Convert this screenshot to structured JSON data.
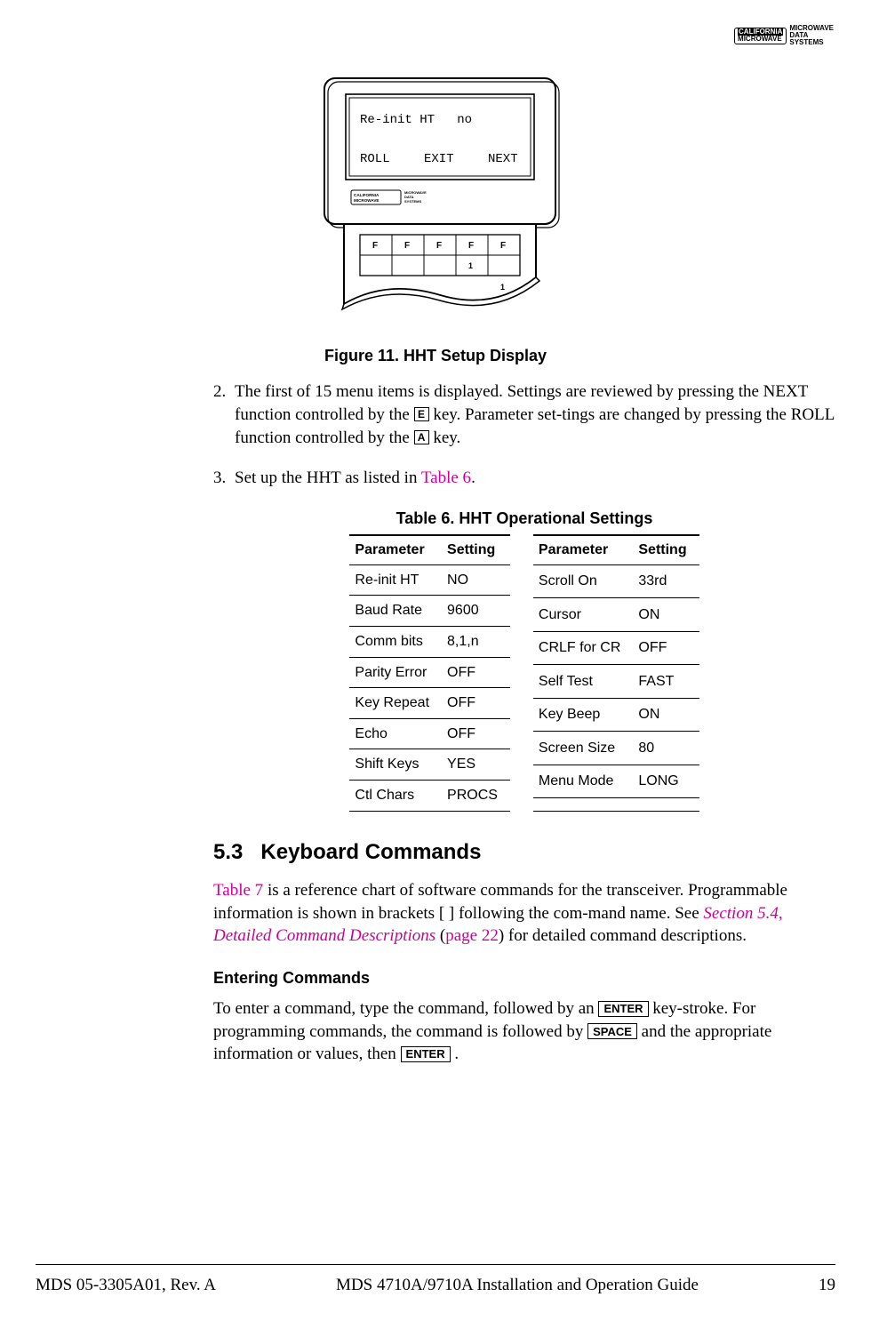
{
  "header": {
    "logo_left_top": "CALIFORNIA",
    "logo_left_bottom": "MICROWAVE",
    "logo_right_l1": "MICROWAVE",
    "logo_right_l2": "DATA",
    "logo_right_l3": "SYSTEMS"
  },
  "figure": {
    "screen_line1": "Re-init HT   no",
    "screen_fn_left": "ROLL",
    "screen_fn_mid": "EXIT",
    "screen_fn_right": "NEXT",
    "caption": "Figure 11. HHT Setup Display",
    "key_F": "F",
    "key_1": "1"
  },
  "steps": {
    "s2_num": "2.",
    "s2_a": "The first of 15 menu items is displayed. Settings are reviewed by pressing the NEXT function controlled by the ",
    "s2_key1": "E",
    "s2_b": " key. Parameter set-tings are changed by pressing the ROLL function controlled by the ",
    "s2_key2": "A",
    "s2_c": " key.",
    "s3_num": "3.",
    "s3_a": "Set up the HHT as listed in ",
    "s3_link": "Table 6",
    "s3_b": "."
  },
  "table": {
    "caption": "Table 6. HHT Operational Settings",
    "h_param": "Parameter",
    "h_setting": "Setting",
    "left": [
      {
        "p": "Re-init HT",
        "s": "NO"
      },
      {
        "p": "Baud Rate",
        "s": "9600"
      },
      {
        "p": "Comm bits",
        "s": "8,1,n"
      },
      {
        "p": "Parity Error",
        "s": "OFF"
      },
      {
        "p": "Key Repeat",
        "s": "OFF"
      },
      {
        "p": "Echo",
        "s": "OFF"
      },
      {
        "p": "Shift Keys",
        "s": "YES"
      },
      {
        "p": "Ctl Chars",
        "s": "PROCS"
      }
    ],
    "right": [
      {
        "p": "Scroll On",
        "s": "33rd"
      },
      {
        "p": "Cursor",
        "s": "ON"
      },
      {
        "p": "CRLF for CR",
        "s": "OFF"
      },
      {
        "p": "Self Test",
        "s": "FAST"
      },
      {
        "p": "Key Beep",
        "s": "ON"
      },
      {
        "p": "Screen Size",
        "s": "80"
      },
      {
        "p": "Menu Mode",
        "s": "LONG"
      },
      {
        "p": "",
        "s": ""
      }
    ]
  },
  "section": {
    "num": "5.3",
    "title": "Keyboard Commands",
    "p1_link1": "Table 7",
    "p1_a": " is a reference chart of software commands for the transceiver. Programmable information is shown in brackets [ ] following the com-mand name. See ",
    "p1_link2": "Section 5.4, Detailed Command Descriptions",
    "p1_b": " (",
    "p1_link3": "page 22",
    "p1_c": ") for detailed command descriptions.",
    "sub": "Entering Commands",
    "p2_a": "To enter a command, type the command, followed by an ",
    "p2_key1": "ENTER",
    "p2_b": " key-stroke. For programming commands, the command is followed by ",
    "p2_key2": "SPACE",
    "p2_c": " and the appropriate information or values, then ",
    "p2_key3": "ENTER",
    "p2_d": " ."
  },
  "footer": {
    "left": "MDS 05-3305A01, Rev. A",
    "center": "MDS 4710A/9710A Installation and Operation Guide",
    "right": "19"
  }
}
